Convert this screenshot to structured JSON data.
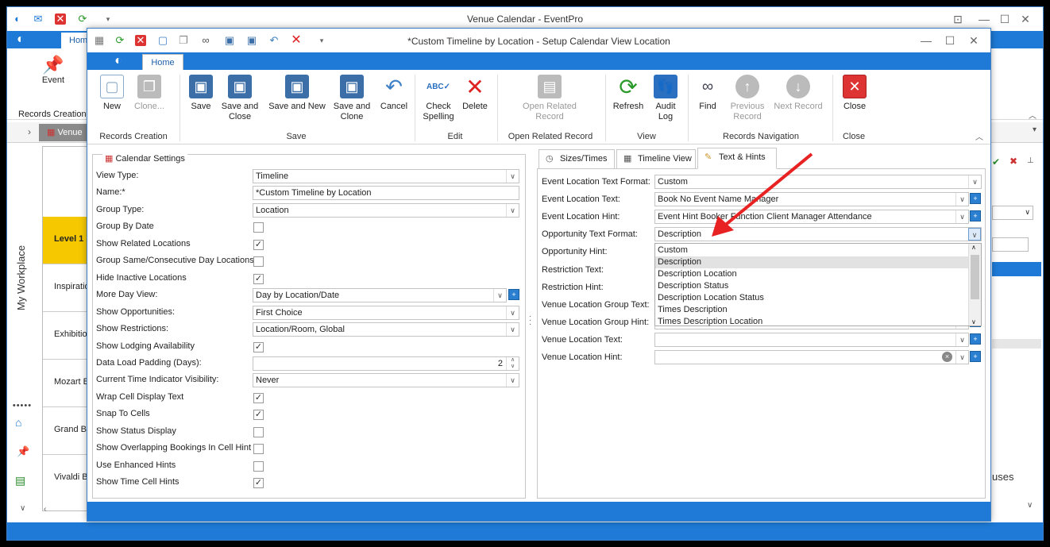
{
  "main_window": {
    "title": "Venue Calendar - EventPro",
    "home_tab": "Home",
    "event_button": "Event",
    "records_creation": "Records Creation",
    "venue_tab": "Venue",
    "my_workplace": "My Workplace",
    "rows": [
      "Level 1",
      "Inspiratio",
      "Exhibitio",
      "Mozart B",
      "Grand Ba",
      "Vivaldi B"
    ],
    "right_partial": "uses"
  },
  "dialog": {
    "title": "*Custom Timeline by Location - Setup Calendar View Location",
    "home_tab": "Home",
    "ribbon": {
      "new": "New",
      "clone": "Clone...",
      "save": "Save",
      "save_close": "Save and Close",
      "save_new": "Save and New",
      "save_clone": "Save and Clone",
      "cancel": "Cancel",
      "check_spelling": "Check Spelling",
      "delete": "Delete",
      "open_related": "Open Related Record",
      "refresh": "Refresh",
      "audit_log": "Audit Log",
      "find": "Find",
      "previous": "Previous Record",
      "next": "Next Record",
      "close": "Close",
      "groups": {
        "records_creation": "Records Creation",
        "save": "Save",
        "edit": "Edit",
        "open_related": "Open Related Record",
        "view": "View",
        "records_navigation": "Records Navigation",
        "close": "Close"
      }
    },
    "calendar_settings": {
      "header": "Calendar Settings",
      "fields": [
        {
          "label": "View Type:",
          "value": "Timeline",
          "kind": "dropdown"
        },
        {
          "label": "Name:*",
          "value": "*Custom Timeline by Location",
          "kind": "text"
        },
        {
          "label": "Group Type:",
          "value": "Location",
          "kind": "dropdown"
        },
        {
          "label": "Group By Date",
          "checked": false,
          "kind": "check"
        },
        {
          "label": "Show Related Locations",
          "checked": true,
          "kind": "check"
        },
        {
          "label": "Group Same/Consecutive Day Locations",
          "checked": false,
          "kind": "check"
        },
        {
          "label": "Hide Inactive Locations",
          "checked": true,
          "kind": "check"
        },
        {
          "label": "More Day View:",
          "value": "Day by Location/Date",
          "kind": "dropdown-add"
        },
        {
          "label": "Show Opportunities:",
          "value": "First Choice",
          "kind": "dropdown"
        },
        {
          "label": "Show Restrictions:",
          "value": "Location/Room, Global",
          "kind": "dropdown"
        },
        {
          "label": "Show Lodging Availability",
          "checked": true,
          "kind": "check"
        },
        {
          "label": "Data Load Padding (Days):",
          "value": "2",
          "kind": "spin"
        },
        {
          "label": "Current Time Indicator Visibility:",
          "value": "Never",
          "kind": "dropdown"
        },
        {
          "label": "Wrap Cell Display Text",
          "checked": true,
          "kind": "check"
        },
        {
          "label": "Snap To Cells",
          "checked": true,
          "kind": "check"
        },
        {
          "label": "Show Status Display",
          "checked": false,
          "kind": "check"
        },
        {
          "label": "Show Overlapping Bookings In Cell Hint",
          "checked": false,
          "kind": "check"
        },
        {
          "label": "Use Enhanced Hints",
          "checked": false,
          "kind": "check"
        },
        {
          "label": "Show Time Cell Hints",
          "checked": true,
          "kind": "check"
        }
      ]
    },
    "tabs": [
      "Sizes/Times",
      "Timeline View",
      "Text & Hints"
    ],
    "text_hints": [
      {
        "label": "Event Location Text Format:",
        "value": "Custom"
      },
      {
        "label": "Event Location Text:",
        "value": "Book No Event Name Manager"
      },
      {
        "label": "Event Location Hint:",
        "value": "Event Hint Booker Function Client Manager Attendance"
      },
      {
        "label": "Opportunity Text Format:",
        "value": "Description"
      },
      {
        "label": "Opportunity Hint:",
        "value": ""
      },
      {
        "label": "Restriction Text:",
        "value": ""
      },
      {
        "label": "Restriction Hint:",
        "value": ""
      },
      {
        "label": "Venue Location Group Text:",
        "value": ""
      },
      {
        "label": "Venue Location Group Hint:",
        "value": ""
      },
      {
        "label": "Venue Location Text:",
        "value": ""
      },
      {
        "label": "Venue Location Hint:",
        "value": ""
      }
    ],
    "dropdown_options": [
      "Custom",
      "Description",
      "Description Location",
      "Description Status",
      "Description Location Status",
      "Times Description",
      "Times Description Location"
    ],
    "dropdown_selected": "Description"
  }
}
